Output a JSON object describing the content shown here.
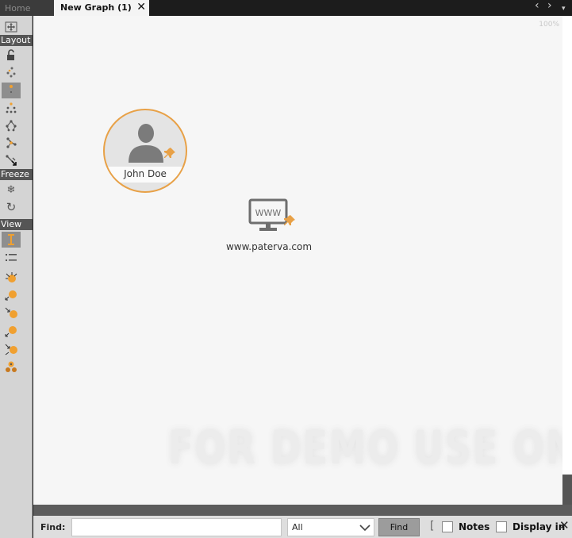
{
  "tabs": {
    "home_label": "Home",
    "active_label": "New Graph (1)",
    "close_glyph": "✕",
    "prev_glyph": "‹",
    "next_glyph": "›"
  },
  "toolbar": {
    "sections": {
      "layout": "Layout",
      "freeze": "Freeze",
      "view": "View"
    },
    "icons": [
      "expand-arrows-icon",
      "unlock-icon",
      "block-layout-icon",
      "hierarchical-layout-icon",
      "centrality-layout-icon",
      "organic-layout-icon",
      "circular-layout-icon",
      "interactive-layout-icon",
      "freeze-snowflake-icon",
      "refresh-icon",
      "node-size-icon",
      "list-view-icon",
      "ranked-incoming-icon",
      "ranked-outgoing-icon",
      "ranked-bidirectional-icon",
      "ranked-links-in-icon",
      "ranked-links-out-icon",
      "entity-group-icon"
    ]
  },
  "canvas": {
    "zoom": "100%",
    "watermark": "FOR DEMO USE ONLY",
    "nodes": {
      "person": {
        "name": "John Doe",
        "icon": "person-silhouette-icon"
      },
      "website": {
        "url": "www.paterva.com",
        "badge": "WWW",
        "icon": "monitor-icon"
      }
    },
    "colors": {
      "accent": "#e8a147",
      "pin": "#e8a147"
    }
  },
  "findbar": {
    "label": "Find:",
    "query": "",
    "scope": "All",
    "button": "Find",
    "notes_label": "Notes",
    "display_label": "Display in",
    "close_glyph": "✕"
  }
}
